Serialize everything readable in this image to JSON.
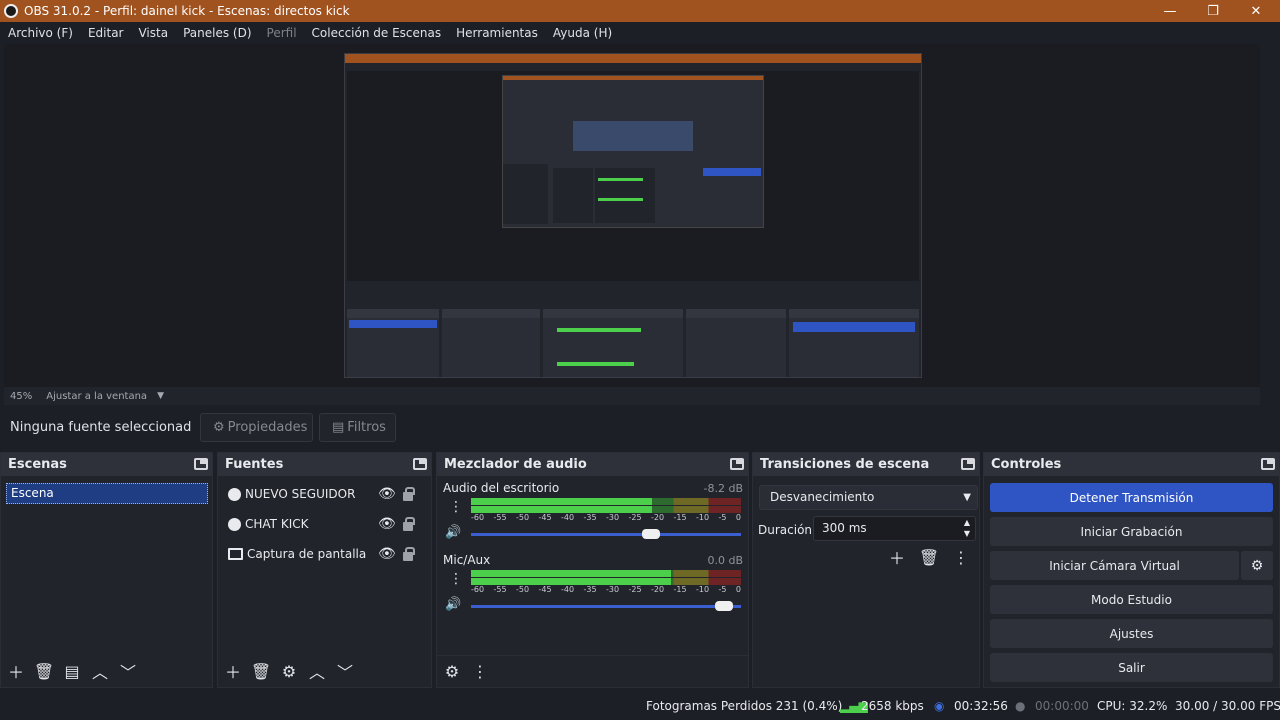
{
  "window": {
    "title": "OBS 31.0.2 - Perfil: dainel kick - Escenas: directos kick",
    "minimize": "—",
    "maximize": "❐",
    "close": "✕"
  },
  "menu": [
    "Archivo (F)",
    "Editar",
    "Vista",
    "Paneles (D)",
    "Perfil",
    "Colección de Escenas",
    "Herramientas",
    "Ayuda (H)"
  ],
  "zoom": {
    "percent": "45%",
    "fit_label": "Ajustar a la ventana",
    "dropdown": "▼"
  },
  "source_toolbar": {
    "no_selection": "Ninguna fuente seleccionad",
    "properties": "Propiedades",
    "filters": "Filtros"
  },
  "scenes": {
    "title": "Escenas",
    "items": [
      "Escena"
    ]
  },
  "sources": {
    "title": "Fuentes",
    "items": [
      {
        "name": "NUEVO SEGUIDOR",
        "icon": "browser-icon"
      },
      {
        "name": "CHAT KICK",
        "icon": "browser-icon"
      },
      {
        "name": "Captura de pantalla",
        "icon": "monitor-icon"
      }
    ]
  },
  "mixer": {
    "title": "Mezclador de audio",
    "channels": [
      {
        "name": "Audio del escritorio",
        "db": "-8.2 dB",
        "level": 0.67,
        "volume": 0.7
      },
      {
        "name": "Mic/Aux",
        "db": "0.0 dB",
        "level": 0.74,
        "volume": 0.97
      }
    ],
    "scale": [
      "-60",
      "-55",
      "-50",
      "-45",
      "-40",
      "-35",
      "-30",
      "-25",
      "-20",
      "-15",
      "-10",
      "-5",
      "0"
    ]
  },
  "transitions": {
    "title": "Transiciones de escena",
    "selected": "Desvanecimiento",
    "duration_label": "Duración",
    "duration_value": "300 ms"
  },
  "controls": {
    "title": "Controles",
    "stop_stream": "Detener Transmisión",
    "start_recording": "Iniciar Grabación",
    "start_virtual_cam": "Iniciar Cámara Virtual",
    "studio_mode": "Modo Estudio",
    "settings": "Ajustes",
    "exit": "Salir"
  },
  "status": {
    "dropped_frames": "Fotogramas Perdidos 231 (0.4%)",
    "bitrate": "2658 kbps",
    "stream_time": "00:32:56",
    "record_time": "00:00:00",
    "cpu": "CPU: 32.2%",
    "fps": "30.00 / 30.00 FPS"
  },
  "colors": {
    "titlebar": "#a0521f",
    "accent": "#2f55c4",
    "background": "#1d1f26"
  }
}
